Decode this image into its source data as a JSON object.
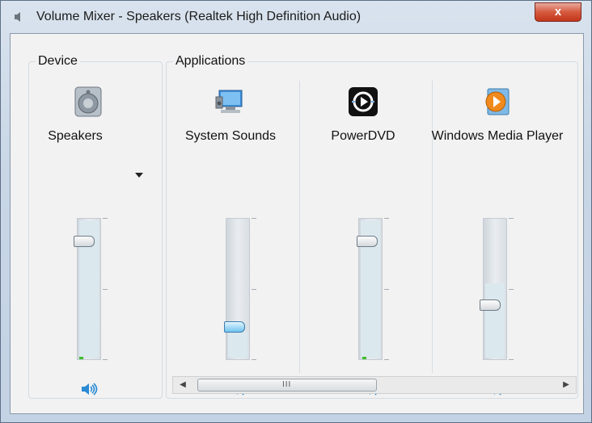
{
  "window": {
    "title": "Volume Mixer - Speakers (Realtek High Definition Audio)",
    "close_label": "x"
  },
  "device": {
    "group_label": "Device",
    "name": "Speakers",
    "volume_percent": 100,
    "icon": "speaker-device-icon"
  },
  "applications": {
    "group_label": "Applications",
    "items": [
      {
        "name": "System Sounds",
        "volume_percent": 22,
        "icon": "system-sounds-icon"
      },
      {
        "name": "PowerDVD",
        "volume_percent": 100,
        "icon": "powerdvd-icon"
      },
      {
        "name": "Windows Media Player",
        "volume_percent": 55,
        "icon": "windows-media-player-icon"
      }
    ]
  },
  "scrollbar": {
    "grip": "III"
  },
  "colors": {
    "accent": "#2a8ad4",
    "level": "#3cbf2b"
  }
}
